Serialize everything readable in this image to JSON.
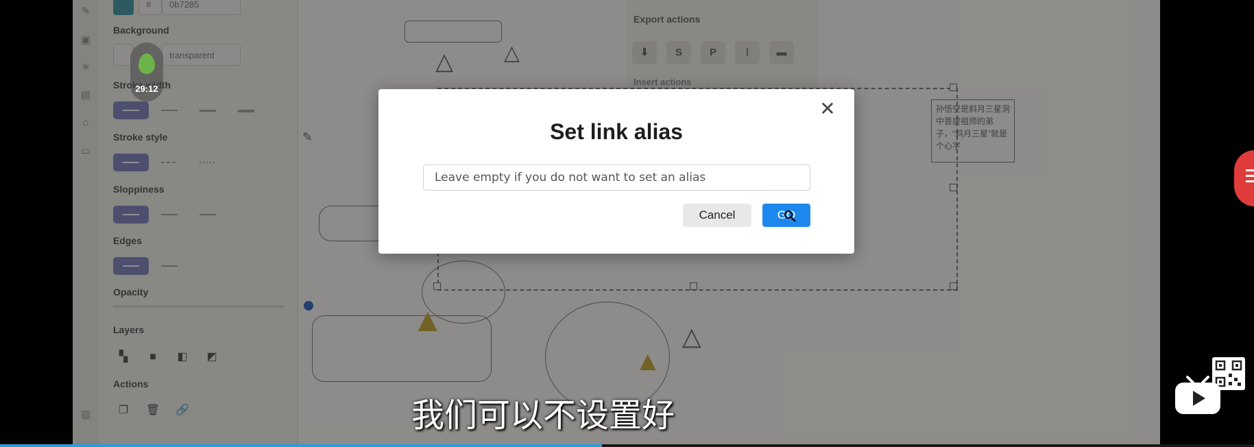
{
  "dialog": {
    "title": "Set link alias",
    "input_placeholder": "Leave empty if you do not want to set an alias",
    "cancel_label": "Cancel",
    "go_label": "GO",
    "close_glyph": "✕"
  },
  "properties_panel": {
    "stroke_color_hex": "0b7285",
    "hash_glyph": "#",
    "background_label": "Background",
    "background_value": "transparent",
    "stroke_width_label": "Stroke width",
    "stroke_style_label": "Stroke style",
    "sloppiness_label": "Sloppiness",
    "edges_label": "Edges",
    "opacity_label": "Opacity",
    "layers_label": "Layers",
    "actions_label": "Actions"
  },
  "export_panel": {
    "export_label": "Export actions",
    "insert_label": "Insert actions",
    "buttons": [
      "⬇",
      "S",
      "P",
      "⁞",
      "▬"
    ]
  },
  "canvas": {
    "note_text": "孙悟空是斜月三星洞中菩提祖师的弟子，“斜月三星”就是个心字"
  },
  "overlay": {
    "timer": "29:12",
    "subtitle": "我们可以不设置好"
  },
  "video": {
    "progress_fraction": 0.48
  },
  "colors": {
    "accent": "#1f88ee",
    "stroke": "#0b7285",
    "float_button": "#e03c3c"
  },
  "icons": {
    "leaf": "leaf-icon",
    "qr": "qr-code-icon",
    "tv": "bilibili-tv-icon",
    "cursor": "mouse-cursor-icon"
  }
}
